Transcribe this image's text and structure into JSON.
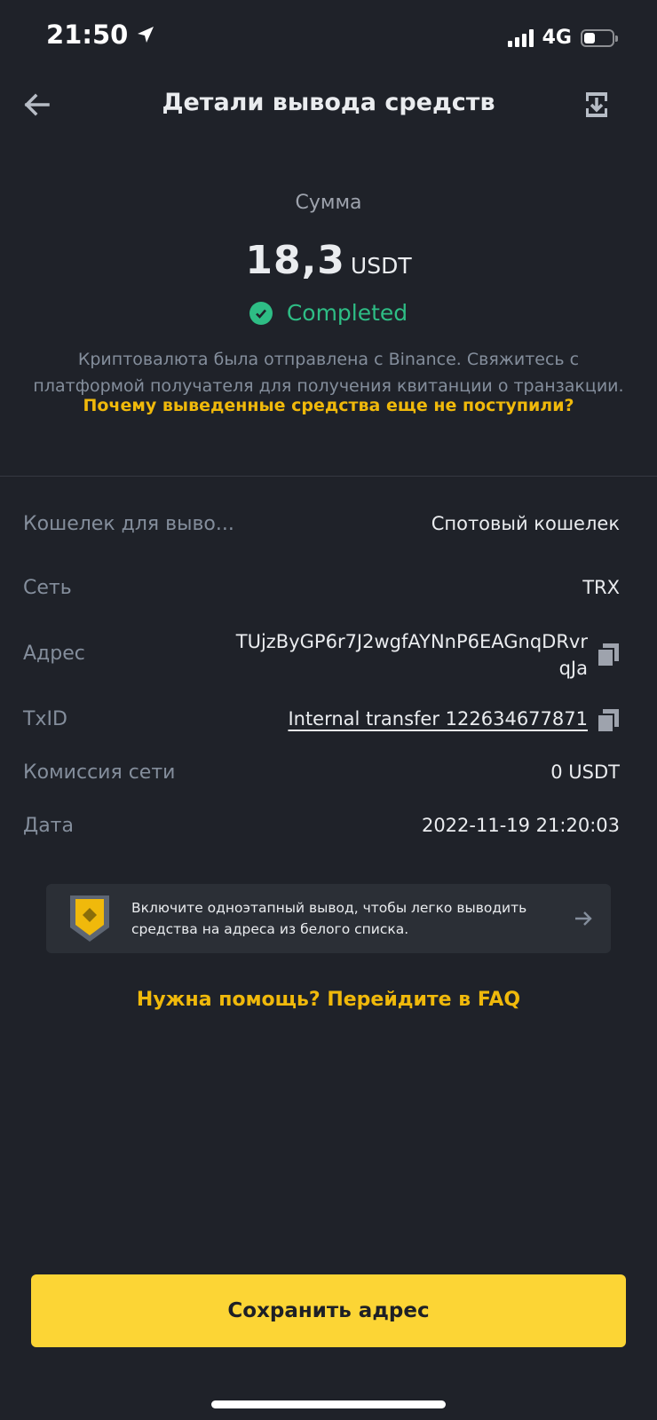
{
  "status_bar": {
    "time": "21:50",
    "network": "4G",
    "icons": [
      "location-arrow-icon",
      "signal-icon",
      "battery-icon"
    ]
  },
  "header": {
    "title": "Детали вывода средств",
    "back_icon": "arrow-left-icon",
    "export_icon": "download-icon"
  },
  "amount": {
    "label": "Сумма",
    "value": "18,3",
    "unit": "USDT",
    "status": "Completed",
    "status_color": "#2ebd85"
  },
  "info": {
    "text": "Криптовалюта была отправлена с Binance. Свяжитесь с платформой получателя для получения квитанции о транзакции.",
    "link": "Почему выведенные средства еще не поступили?"
  },
  "details": {
    "wallet": {
      "label": "Кошелек для выво...",
      "value": "Спотовый кошелек"
    },
    "network": {
      "label": "Сеть",
      "value": "TRX"
    },
    "address": {
      "label": "Адрес",
      "value": "TUjzByGP6r7J2wgfAYNnP6EAGnqDRvrqJa"
    },
    "txid": {
      "label": "TxID",
      "value": "Internal transfer 122634677871"
    },
    "fee": {
      "label": "Комиссия сети",
      "value": "0 USDT"
    },
    "date": {
      "label": "Дата",
      "value": "2022-11-19 21:20:03"
    }
  },
  "banner": {
    "text": "Включите одноэтапный вывод, чтобы легко выводить средства на адреса из белого списка.",
    "icon": "shield-icon"
  },
  "faq": {
    "link": "Нужна помощь? Перейдите в FAQ"
  },
  "actions": {
    "save_label": "Сохранить адрес"
  },
  "colors": {
    "background": "#1f2229",
    "accent": "#fcd535",
    "link": "#f0b90b",
    "muted": "#848e9c"
  }
}
